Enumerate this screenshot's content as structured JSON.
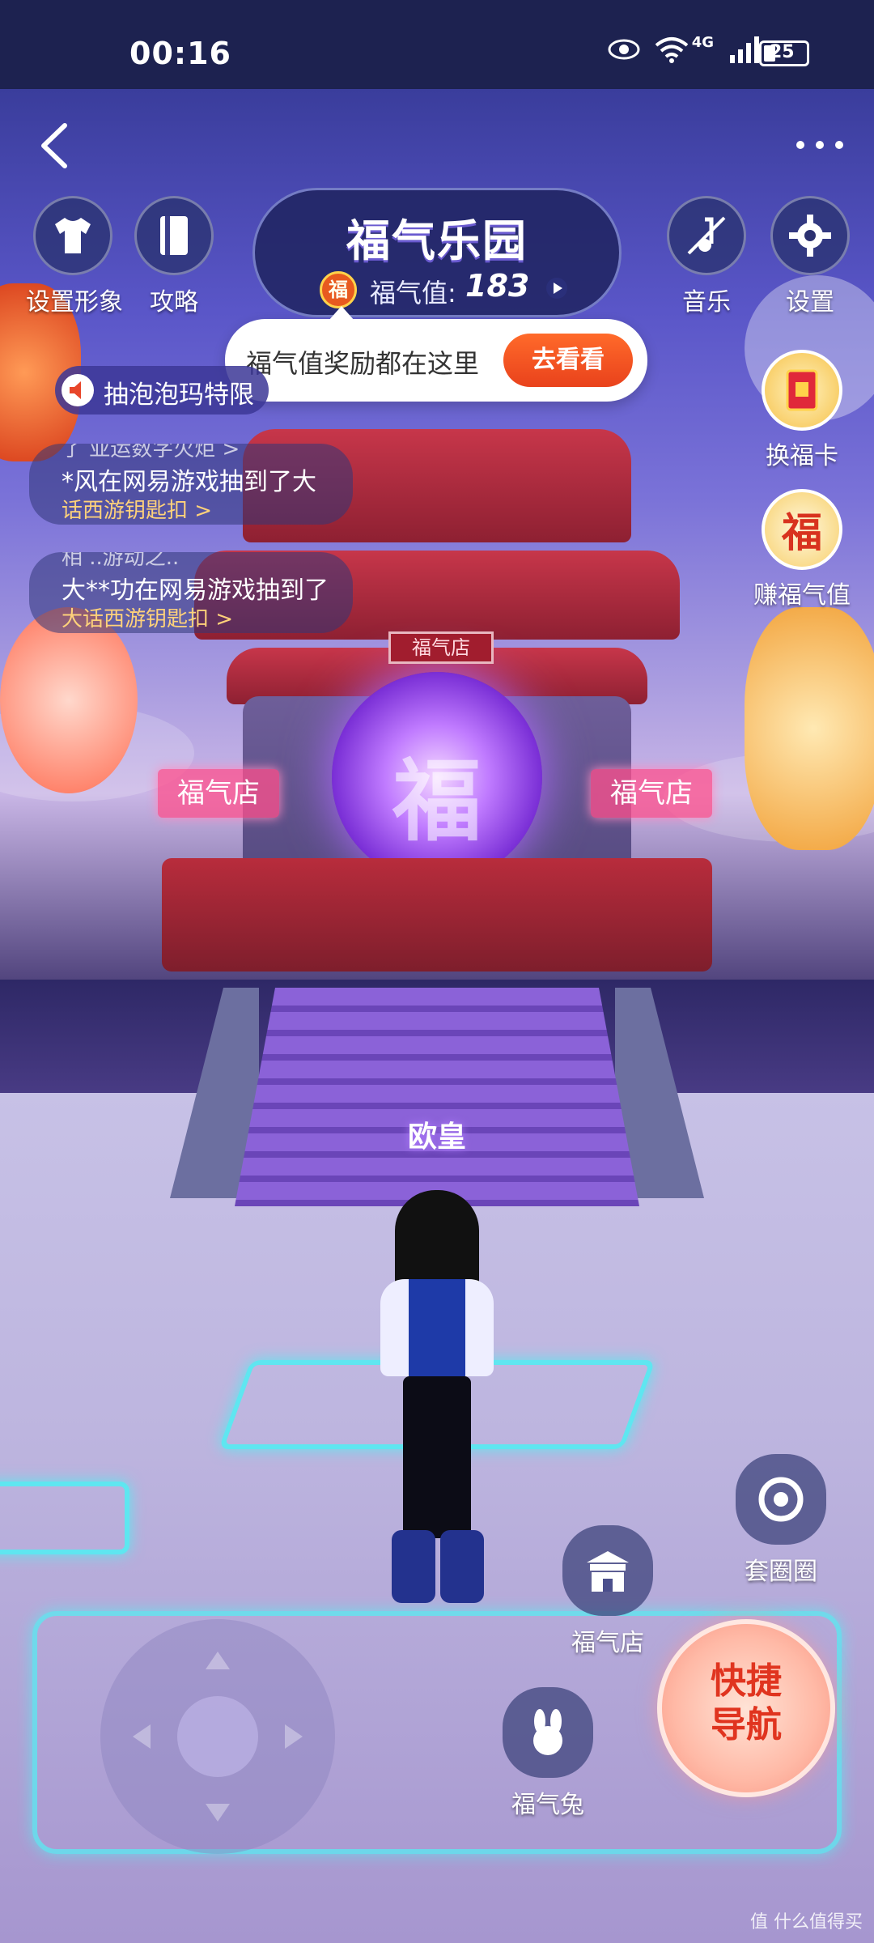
{
  "status_bar": {
    "time": "00:16",
    "network": "4G",
    "battery": "25"
  },
  "header": {
    "title": "福气乐园",
    "fuqi_label": "福气值:",
    "fuqi_value": "183",
    "fu_badge": "福"
  },
  "top_left_buttons": [
    {
      "label": "设置形象",
      "icon": "shirt-icon"
    },
    {
      "label": "攻略",
      "icon": "book-icon"
    }
  ],
  "top_right_buttons": [
    {
      "label": "音乐",
      "icon": "music-note-icon"
    },
    {
      "label": "设置",
      "icon": "gear-icon"
    }
  ],
  "tooltip": {
    "text": "福气值奖励都在这里",
    "button": "去看看"
  },
  "announcement": {
    "text": "抽泡泡玛特限"
  },
  "barrage": [
    {
      "top": "了 亚运数字火炬 >",
      "main": "*风在网易游戏抽到了大",
      "link": "话西游钥匙扣 >"
    },
    {
      "top": "相 ..游动之..",
      "main": "大**功在网易游戏抽到了",
      "link": "大话西游钥匙扣 >"
    }
  ],
  "side_badges": [
    {
      "label": "换福卡",
      "icon": "fu-card-icon"
    },
    {
      "label": "赚福气值",
      "icon": "fu-coin-icon",
      "char": "福"
    }
  ],
  "scene": {
    "shop_sign": "福气店",
    "side_sign_left": "福气店",
    "side_sign_right": "福气店",
    "orb_char": "福",
    "stage_label": "欧皇"
  },
  "bottom_buttons": [
    {
      "label": "套圈圈",
      "icon": "ring-target-icon"
    },
    {
      "label": "福气店",
      "icon": "shop-icon"
    },
    {
      "label": "福气兔",
      "icon": "rabbit-icon"
    }
  ],
  "quick_nav": {
    "line1": "快捷",
    "line2": "导航"
  },
  "watermark": "值 什么值得买"
}
